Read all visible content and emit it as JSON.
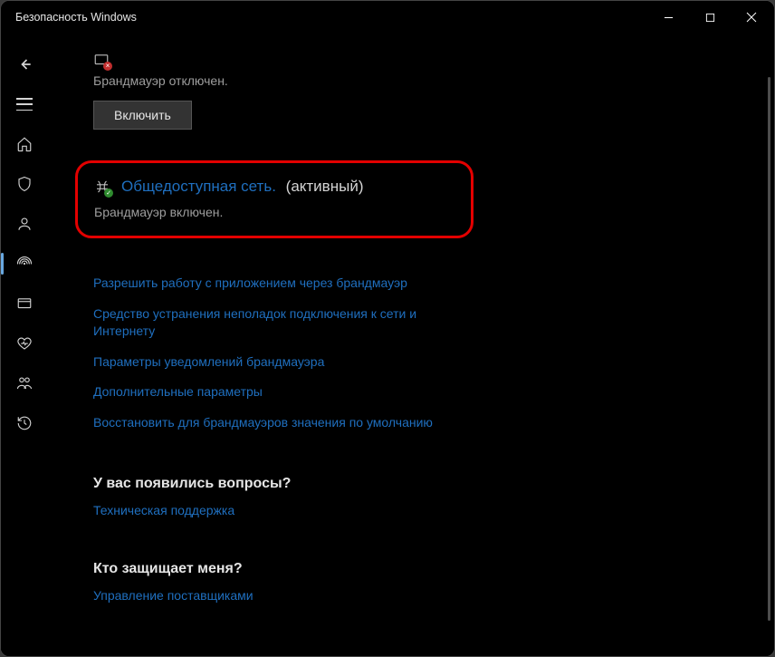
{
  "window": {
    "title": "Безопасность Windows"
  },
  "private_network": {
    "title_truncated": "",
    "status": "Брандмауэр отключен.",
    "button_label": "Включить"
  },
  "public_network": {
    "title": "Общедоступная сеть.",
    "active_suffix": "(активный)",
    "status": "Брандмауэр включен."
  },
  "firewall_links": {
    "allow_app": "Разрешить работу с приложением через брандмауэр",
    "troubleshoot": "Средство устранения неполадок подключения к сети и Интернету",
    "notifications": "Параметры уведомлений брандмауэра",
    "advanced": "Дополнительные параметры",
    "restore_defaults": "Восстановить для брандмауэров значения по умолчанию"
  },
  "questions_section": {
    "heading": "У вас появились вопросы?",
    "link": "Техническая поддержка"
  },
  "protection_section": {
    "heading": "Кто защищает меня?",
    "link": "Управление поставщиками"
  }
}
